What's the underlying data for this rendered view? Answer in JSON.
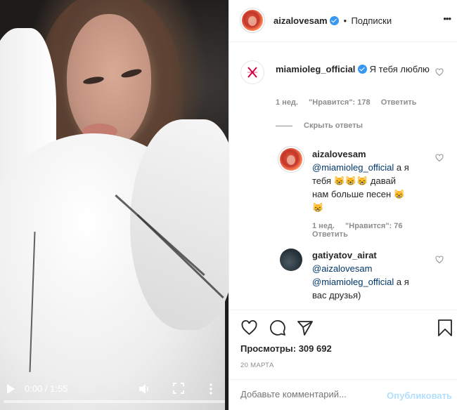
{
  "video": {
    "time": "0:00 / 1:55",
    "progress": 0.0
  },
  "header": {
    "username": "aizalovesam",
    "dot": "•",
    "follow_label": "Подписки",
    "more": "•••"
  },
  "comments": [
    {
      "username": "miamioleg_official",
      "text": "Я тебя люблю",
      "age": "1 нед.",
      "likes": "\"Нравится\": 178",
      "reply": "Ответить"
    }
  ],
  "hide_replies": "Скрыть ответы",
  "replies": [
    {
      "username": "aizalovesam",
      "mention": "@miamioleg_official",
      "text1": " а я",
      "text2": "тебя",
      "text3": " давай",
      "text4": "нам больше песен",
      "age": "1 нед.",
      "likes": "\"Нравится\": 76",
      "reply": "Ответить"
    },
    {
      "username": "gatiyatov_airat",
      "mention1": "@aizalovesam",
      "mention2": "@miamioleg_official",
      "text1": " а я",
      "text2": "вас друзья)"
    }
  ],
  "views": "Просмотры: 309 692",
  "date": "20 МАРТА",
  "add_comment_placeholder": "Добавьте комментарий...",
  "publish_label": "Опубликовать",
  "emoji_char": "😸"
}
